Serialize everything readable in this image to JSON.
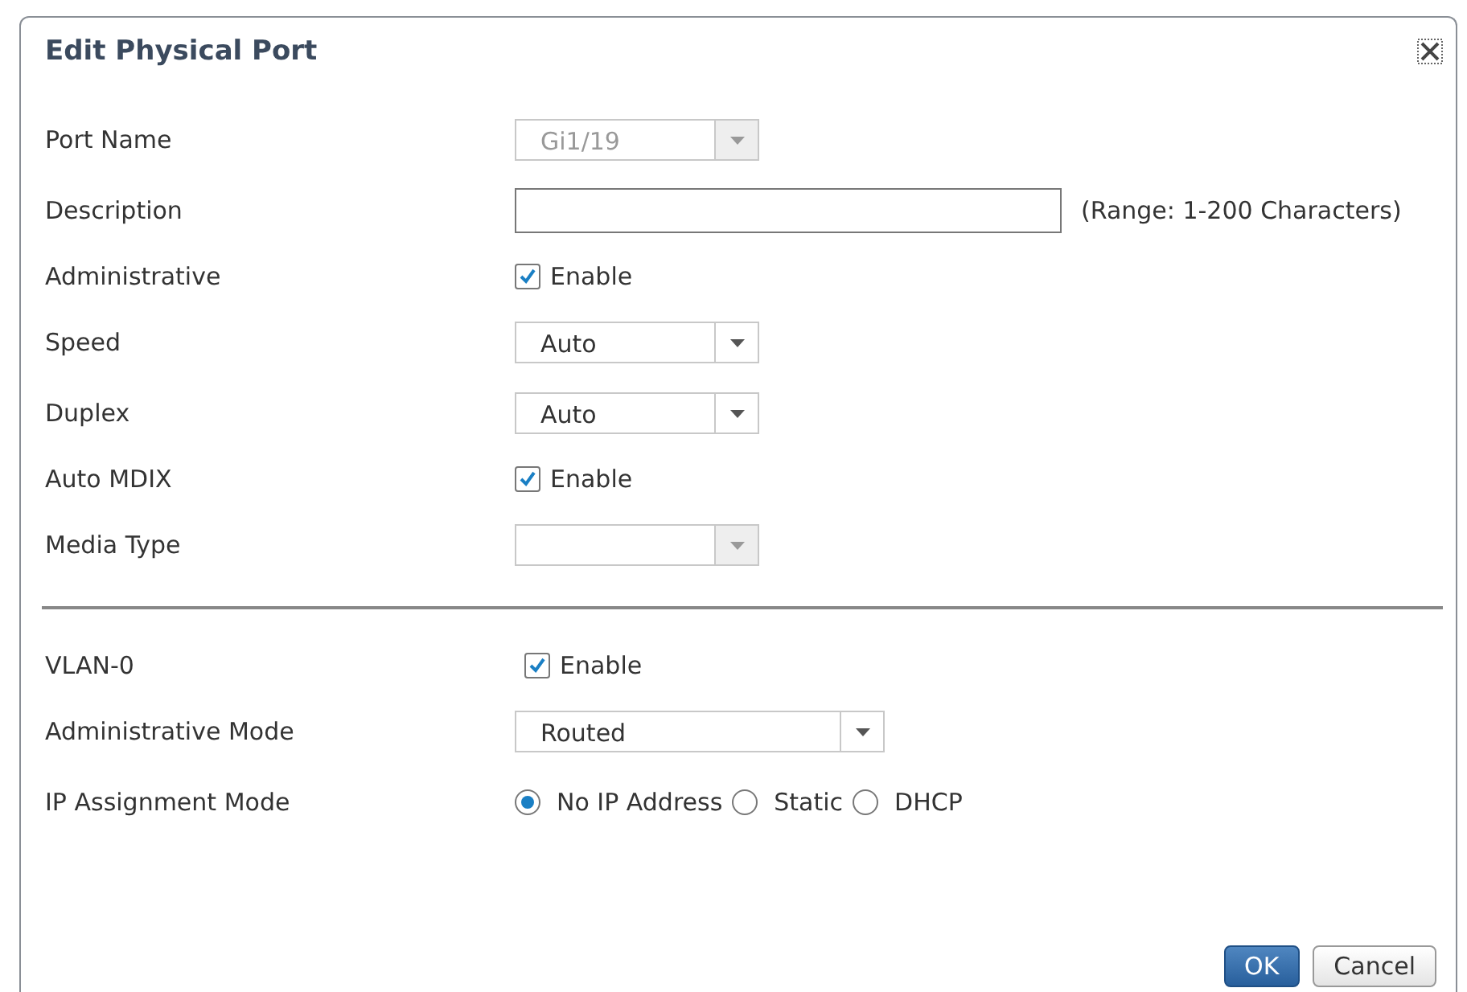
{
  "dialog": {
    "title": "Edit Physical Port"
  },
  "sections": [
    {
      "fields": [
        {
          "kind": "select",
          "label": "Port Name",
          "value": "Gi1/19",
          "disabled": true
        },
        {
          "kind": "text",
          "label": "Description",
          "hint": "(Range: 1-200 Characters)"
        },
        {
          "kind": "checkbox",
          "label": "Administrative",
          "option": "Enable",
          "checked": true
        },
        {
          "kind": "select",
          "label": "Speed",
          "value": "Auto",
          "disabled": false
        },
        {
          "kind": "select",
          "label": "Duplex",
          "value": "Auto",
          "disabled": false
        },
        {
          "kind": "checkbox",
          "label": "Auto MDIX",
          "option": "Enable",
          "checked": true
        },
        {
          "kind": "select",
          "label": "Media Type",
          "disabled": true
        }
      ]
    },
    {
      "fields": [
        {
          "kind": "checkbox",
          "label": "VLAN-0",
          "option": "Enable",
          "checked": true
        },
        {
          "kind": "select",
          "label": "Administrative Mode",
          "value": "Routed",
          "disabled": false
        },
        {
          "kind": "radio",
          "label": "IP Assignment Mode",
          "options": [
            {
              "label": "No IP Address",
              "selected": true
            },
            {
              "label": "Static",
              "selected": false
            },
            {
              "label": "DHCP",
              "selected": false
            }
          ]
        }
      ]
    }
  ],
  "buttons": [
    {
      "label": "OK",
      "primary": true
    },
    {
      "label": "Cancel",
      "primary": false
    }
  ]
}
